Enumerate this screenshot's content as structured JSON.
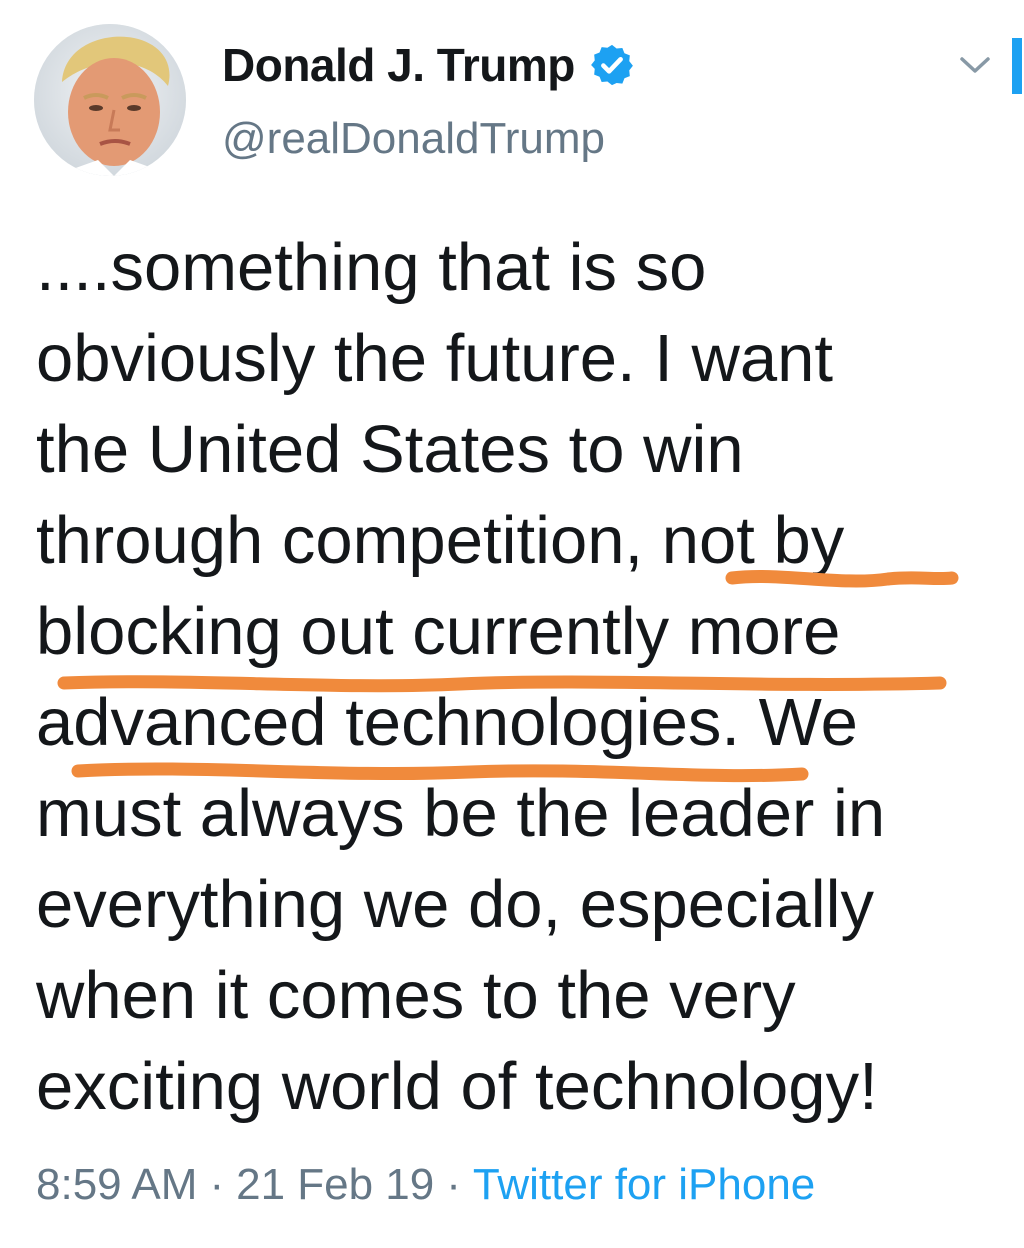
{
  "author": {
    "display_name": "Donald J. Trump",
    "handle": "@realDonaldTrump",
    "verified_badge_icon": "verified-badge-icon",
    "avatar_icon": "profile-photo"
  },
  "menu": {
    "icon": "chevron-down-icon"
  },
  "tweet": {
    "lines": [
      "....something that is so",
      "obviously the future. I want",
      "the United States to win",
      "through competition, not by",
      "blocking out currently more",
      "advanced technologies. We",
      "must always be the leader in",
      "everything we do, especially",
      "when it comes to the very",
      "exciting world of technology!"
    ]
  },
  "meta": {
    "time": "8:59 AM",
    "separator": "·",
    "date": "21 Feb 19",
    "source": "Twitter for iPhone"
  },
  "colors": {
    "text": "#14171a",
    "secondary_text": "#657786",
    "link": "#1da1f2",
    "verified": "#1da1f2",
    "underline_annotation": "#f08a3c"
  }
}
